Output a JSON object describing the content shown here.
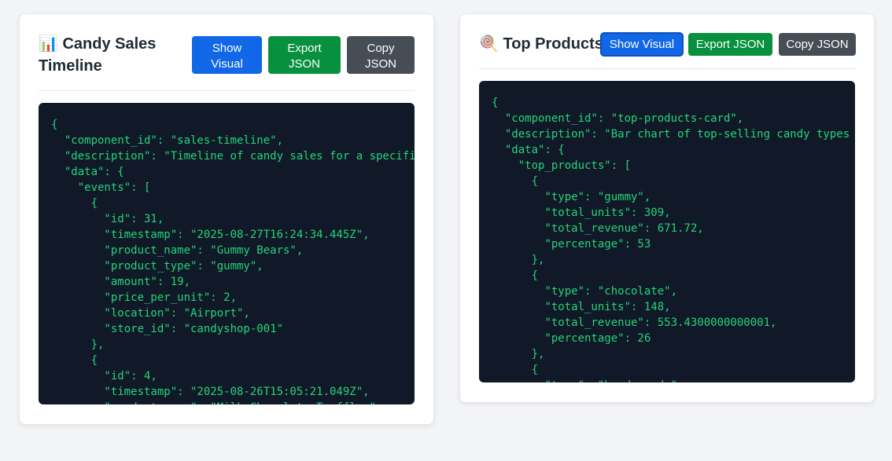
{
  "left_card": {
    "title": "📊 Candy Sales Timeline",
    "buttons": {
      "show_visual": "Show Visual",
      "export_json": "Export JSON",
      "copy_json": "Copy JSON"
    },
    "code": "{\n  \"component_id\": \"sales-timeline\",\n  \"description\": \"Timeline of candy sales for a specific\n  \"data\": {\n    \"events\": [\n      {\n        \"id\": 31,\n        \"timestamp\": \"2025-08-27T16:24:34.445Z\",\n        \"product_name\": \"Gummy Bears\",\n        \"product_type\": \"gummy\",\n        \"amount\": 19,\n        \"price_per_unit\": 2,\n        \"location\": \"Airport\",\n        \"store_id\": \"candyshop-001\"\n      },\n      {\n        \"id\": 4,\n        \"timestamp\": \"2025-08-26T15:05:21.049Z\",\n        \"product_name\": \"Milk Chocolate Truffles\","
  },
  "right_card": {
    "title": "🍭 Top Products",
    "buttons": {
      "show_visual": "Show Visual",
      "export_json": "Export JSON",
      "copy_json": "Copy JSON"
    },
    "code": "{\n  \"component_id\": \"top-products-card\",\n  \"description\": \"Bar chart of top-selling candy types\n  \"data\": {\n    \"top_products\": [\n      {\n        \"type\": \"gummy\",\n        \"total_units\": 309,\n        \"total_revenue\": 671.72,\n        \"percentage\": 53\n      },\n      {\n        \"type\": \"chocolate\",\n        \"total_units\": 148,\n        \"total_revenue\": 553.4300000000001,\n        \"percentage\": 26\n      },\n      {\n        \"type\": \"hard_candy\","
  },
  "colors": {
    "show_button": "#1167e6",
    "export_button": "#07903d",
    "copy_button": "#474d55",
    "code_background": "#111827",
    "code_text": "#22d67a"
  }
}
